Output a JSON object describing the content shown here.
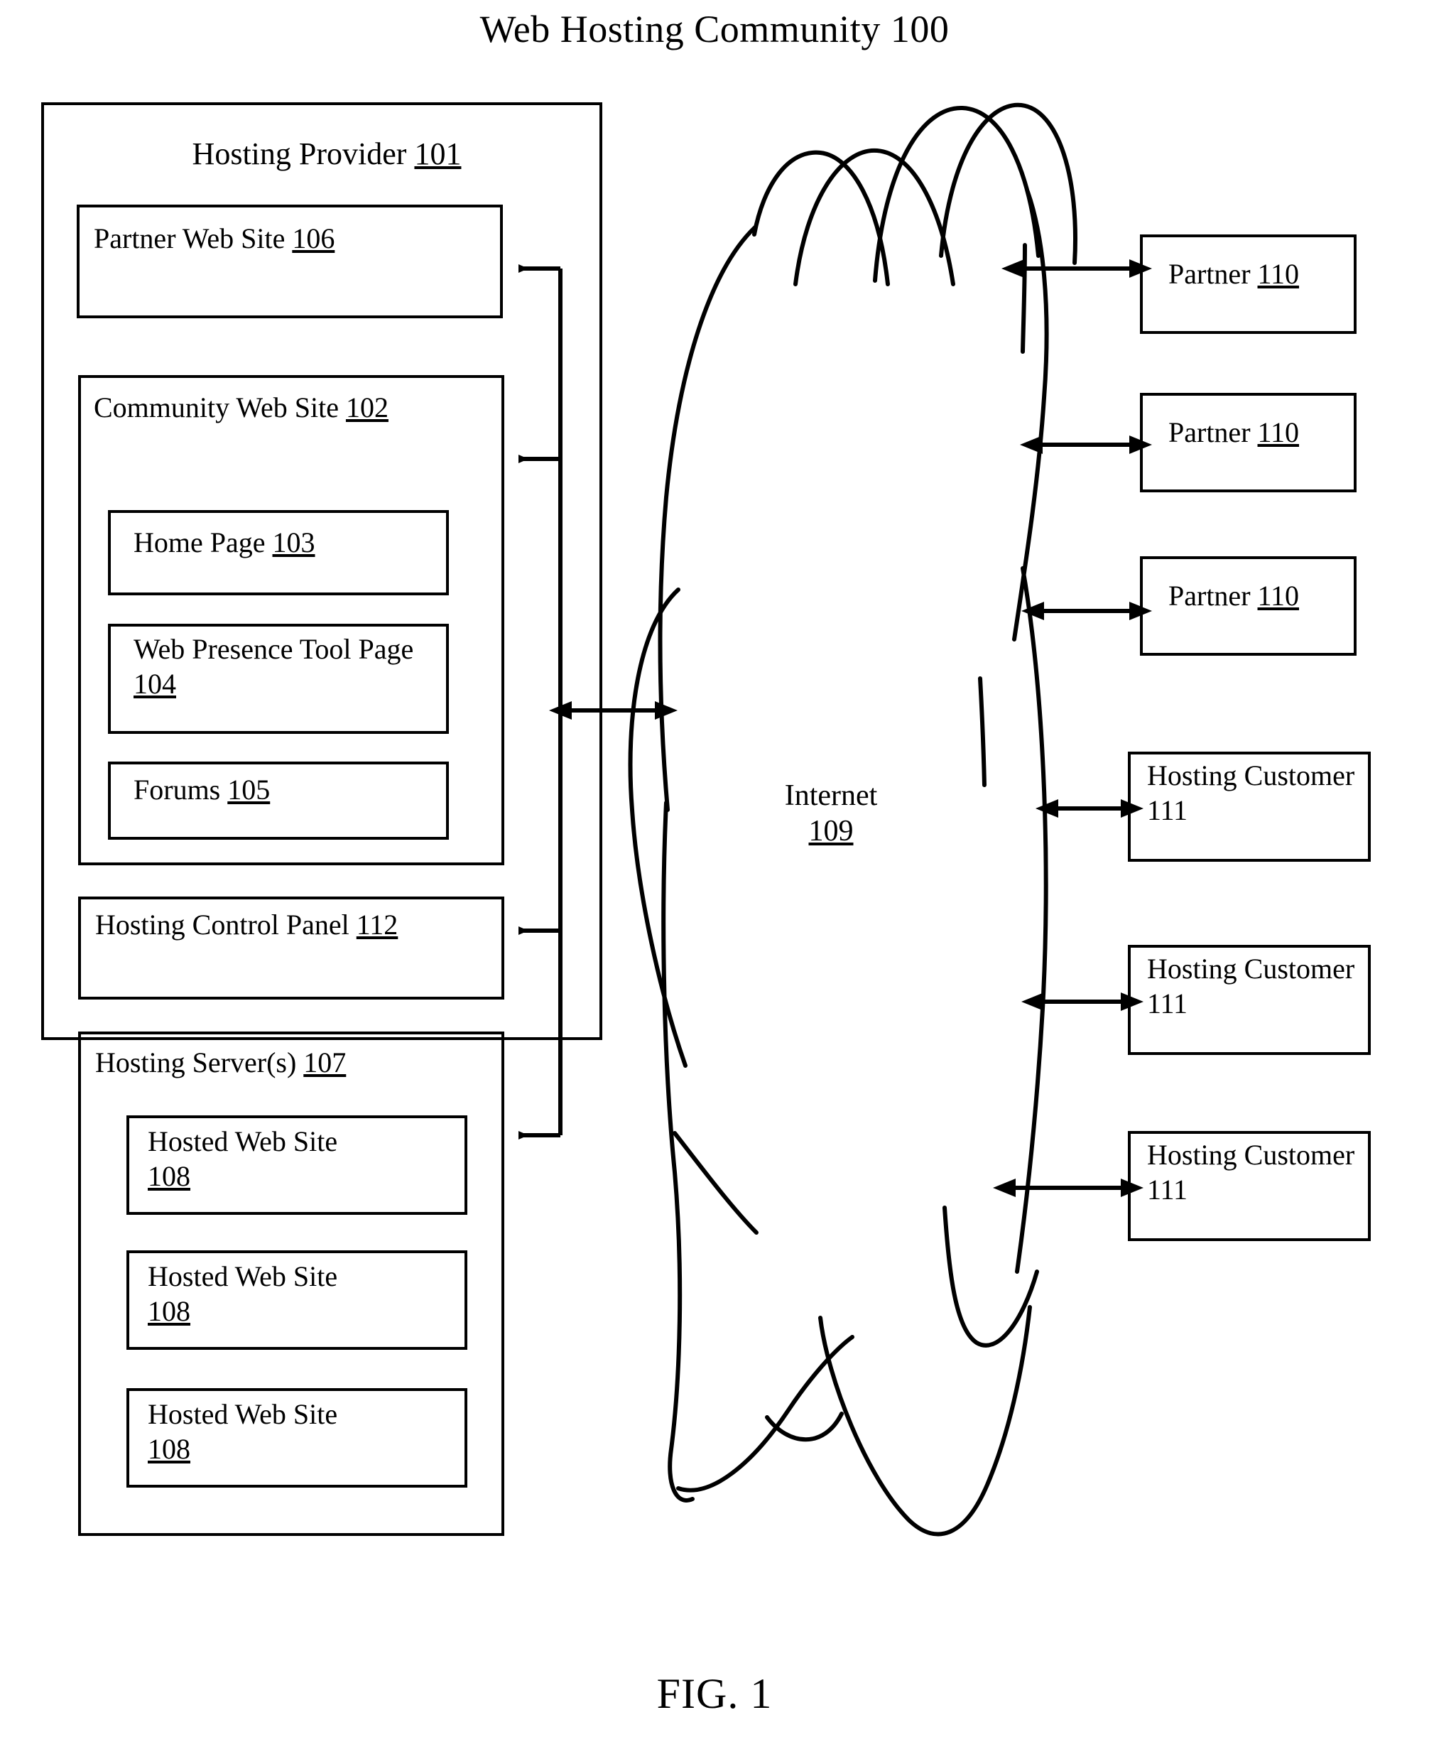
{
  "figure": {
    "title": "Web Hosting Community 100",
    "caption": "FIG. 1"
  },
  "hosting_provider": {
    "label": "Hosting Provider ",
    "ref": "101",
    "children": {
      "partner_web_site": {
        "label": "Partner Web Site ",
        "ref": "106"
      },
      "community_web_site": {
        "label": "Community Web Site ",
        "ref": "102",
        "children": {
          "home_page": {
            "label": "Home Page ",
            "ref": "103"
          },
          "web_presence_tool_page": {
            "label": "Web Presence Tool Page ",
            "ref": "104"
          },
          "forums": {
            "label": "Forums ",
            "ref": "105"
          }
        }
      },
      "hosting_control_panel": {
        "label": "Hosting Control Panel ",
        "ref": "112"
      },
      "hosting_servers": {
        "label": "Hosting Server(s) ",
        "ref": "107",
        "hosted_sites": [
          {
            "label": "Hosted Web Site",
            "ref": "108"
          },
          {
            "label": "Hosted Web Site",
            "ref": "108"
          },
          {
            "label": "Hosted Web Site",
            "ref": "108"
          }
        ]
      }
    }
  },
  "internet": {
    "label": "Internet",
    "ref": "109"
  },
  "external_nodes": [
    {
      "label": "Partner ",
      "ref": "110",
      "type": "partner"
    },
    {
      "label": "Partner ",
      "ref": "110",
      "type": "partner"
    },
    {
      "label": "Partner ",
      "ref": "110",
      "type": "partner"
    },
    {
      "label": "Hosting Customer 111",
      "ref": "111",
      "type": "customer"
    },
    {
      "label": "Hosting Customer 111",
      "ref": "111",
      "type": "customer"
    },
    {
      "label": "Hosting Customer 111",
      "ref": "111",
      "type": "customer"
    }
  ],
  "colors": {
    "line": "#000000",
    "background": "#ffffff"
  }
}
